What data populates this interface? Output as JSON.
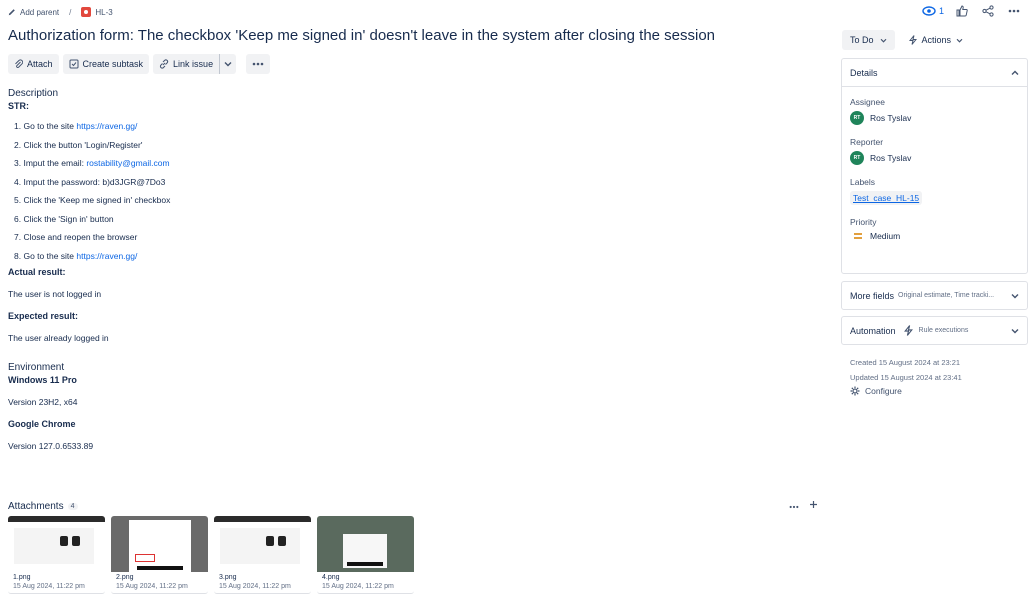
{
  "breadcrumb": {
    "add_parent": "Add parent",
    "separator": "/",
    "issue_key": "HL-3"
  },
  "header": {
    "watchers": "1"
  },
  "title": "Authorization form: The checkbox 'Keep me signed in' doesn't leave in the system after closing the session",
  "toolbar": {
    "attach": "Attach",
    "create_subtask": "Create subtask",
    "link_issue": "Link issue"
  },
  "description": {
    "label": "Description",
    "str_label": "STR:",
    "steps": [
      {
        "num": "1.",
        "text": "Go to the site ",
        "link": "https://raven.gg/"
      },
      {
        "num": "2.",
        "text": "Click the button 'Login/Register'",
        "link": ""
      },
      {
        "num": "3.",
        "text": "Imput the email: ",
        "link": "rostability@gmail.com"
      },
      {
        "num": "4.",
        "text": "Imput the password: b)d3JGR@7Do3",
        "link": ""
      },
      {
        "num": "5.",
        "text": "Click the 'Keep me signed in' checkbox",
        "link": ""
      },
      {
        "num": "6.",
        "text": "Click the 'Sign in' button",
        "link": ""
      },
      {
        "num": "7.",
        "text": "Close and reopen the browser",
        "link": ""
      },
      {
        "num": "8.",
        "text": "Go to the site ",
        "link": "https://raven.gg/"
      }
    ],
    "actual_label": "Actual result:",
    "actual_text": "The user is not logged in",
    "expected_label": "Expected result:",
    "expected_text": "The user already logged in"
  },
  "environment": {
    "label": "Environment",
    "os": "Windows 11 Pro",
    "os_version": "Version 23H2, x64",
    "browser": "Google Chrome",
    "browser_version": "Version 127.0.6533.89"
  },
  "attachments": {
    "label": "Attachments",
    "count": "4",
    "items": [
      {
        "name": "1.png",
        "date": "15 Aug 2024, 11:22 pm"
      },
      {
        "name": "2.png",
        "date": "15 Aug 2024, 11:22 pm"
      },
      {
        "name": "3.png",
        "date": "15 Aug 2024, 11:22 pm"
      },
      {
        "name": "4.png",
        "date": "15 Aug 2024, 11:22 pm"
      }
    ]
  },
  "sidebar": {
    "status": "To Do",
    "actions": "Actions",
    "details": {
      "label": "Details",
      "assignee_label": "Assignee",
      "assignee": "Ros Tyslav",
      "assignee_initials": "RT",
      "reporter_label": "Reporter",
      "reporter": "Ros Tyslav",
      "reporter_initials": "RT",
      "labels_label": "Labels",
      "label_value": "Test_case_HL-15",
      "priority_label": "Priority",
      "priority": "Medium"
    },
    "more_fields": {
      "label": "More fields",
      "sub": "Original estimate, Time tracki..."
    },
    "automation": {
      "label": "Automation",
      "sub": "Rule executions"
    },
    "created": "Created 15 August 2024 at 23:21",
    "updated": "Updated 15 August 2024 at 23:41",
    "configure": "Configure"
  },
  "colors": {
    "accent": "#0c66e4",
    "bug": "#e2483d",
    "avatar": "#1f845a",
    "priority_medium": "#e2a03f"
  }
}
